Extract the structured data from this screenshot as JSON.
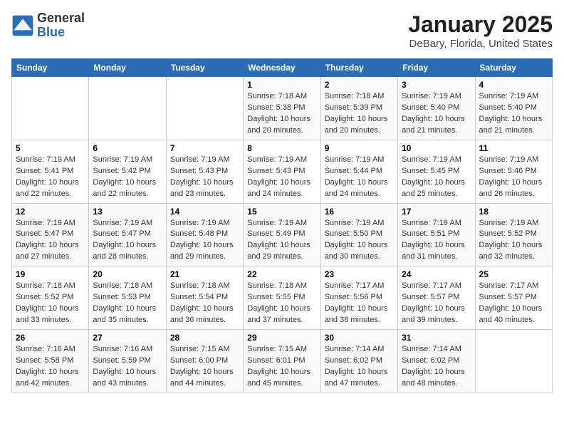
{
  "header": {
    "logo_line1": "General",
    "logo_line2": "Blue",
    "month": "January 2025",
    "location": "DeBary, Florida, United States"
  },
  "days_of_week": [
    "Sunday",
    "Monday",
    "Tuesday",
    "Wednesday",
    "Thursday",
    "Friday",
    "Saturday"
  ],
  "weeks": [
    [
      {
        "day": "",
        "info": ""
      },
      {
        "day": "",
        "info": ""
      },
      {
        "day": "",
        "info": ""
      },
      {
        "day": "1",
        "info": "Sunrise: 7:18 AM\nSunset: 5:38 PM\nDaylight: 10 hours\nand 20 minutes."
      },
      {
        "day": "2",
        "info": "Sunrise: 7:18 AM\nSunset: 5:39 PM\nDaylight: 10 hours\nand 20 minutes."
      },
      {
        "day": "3",
        "info": "Sunrise: 7:19 AM\nSunset: 5:40 PM\nDaylight: 10 hours\nand 21 minutes."
      },
      {
        "day": "4",
        "info": "Sunrise: 7:19 AM\nSunset: 5:40 PM\nDaylight: 10 hours\nand 21 minutes."
      }
    ],
    [
      {
        "day": "5",
        "info": "Sunrise: 7:19 AM\nSunset: 5:41 PM\nDaylight: 10 hours\nand 22 minutes."
      },
      {
        "day": "6",
        "info": "Sunrise: 7:19 AM\nSunset: 5:42 PM\nDaylight: 10 hours\nand 22 minutes."
      },
      {
        "day": "7",
        "info": "Sunrise: 7:19 AM\nSunset: 5:43 PM\nDaylight: 10 hours\nand 23 minutes."
      },
      {
        "day": "8",
        "info": "Sunrise: 7:19 AM\nSunset: 5:43 PM\nDaylight: 10 hours\nand 24 minutes."
      },
      {
        "day": "9",
        "info": "Sunrise: 7:19 AM\nSunset: 5:44 PM\nDaylight: 10 hours\nand 24 minutes."
      },
      {
        "day": "10",
        "info": "Sunrise: 7:19 AM\nSunset: 5:45 PM\nDaylight: 10 hours\nand 25 minutes."
      },
      {
        "day": "11",
        "info": "Sunrise: 7:19 AM\nSunset: 5:46 PM\nDaylight: 10 hours\nand 26 minutes."
      }
    ],
    [
      {
        "day": "12",
        "info": "Sunrise: 7:19 AM\nSunset: 5:47 PM\nDaylight: 10 hours\nand 27 minutes."
      },
      {
        "day": "13",
        "info": "Sunrise: 7:19 AM\nSunset: 5:47 PM\nDaylight: 10 hours\nand 28 minutes."
      },
      {
        "day": "14",
        "info": "Sunrise: 7:19 AM\nSunset: 5:48 PM\nDaylight: 10 hours\nand 29 minutes."
      },
      {
        "day": "15",
        "info": "Sunrise: 7:19 AM\nSunset: 5:49 PM\nDaylight: 10 hours\nand 29 minutes."
      },
      {
        "day": "16",
        "info": "Sunrise: 7:19 AM\nSunset: 5:50 PM\nDaylight: 10 hours\nand 30 minutes."
      },
      {
        "day": "17",
        "info": "Sunrise: 7:19 AM\nSunset: 5:51 PM\nDaylight: 10 hours\nand 31 minutes."
      },
      {
        "day": "18",
        "info": "Sunrise: 7:19 AM\nSunset: 5:52 PM\nDaylight: 10 hours\nand 32 minutes."
      }
    ],
    [
      {
        "day": "19",
        "info": "Sunrise: 7:18 AM\nSunset: 5:52 PM\nDaylight: 10 hours\nand 33 minutes."
      },
      {
        "day": "20",
        "info": "Sunrise: 7:18 AM\nSunset: 5:53 PM\nDaylight: 10 hours\nand 35 minutes."
      },
      {
        "day": "21",
        "info": "Sunrise: 7:18 AM\nSunset: 5:54 PM\nDaylight: 10 hours\nand 36 minutes."
      },
      {
        "day": "22",
        "info": "Sunrise: 7:18 AM\nSunset: 5:55 PM\nDaylight: 10 hours\nand 37 minutes."
      },
      {
        "day": "23",
        "info": "Sunrise: 7:17 AM\nSunset: 5:56 PM\nDaylight: 10 hours\nand 38 minutes."
      },
      {
        "day": "24",
        "info": "Sunrise: 7:17 AM\nSunset: 5:57 PM\nDaylight: 10 hours\nand 39 minutes."
      },
      {
        "day": "25",
        "info": "Sunrise: 7:17 AM\nSunset: 5:57 PM\nDaylight: 10 hours\nand 40 minutes."
      }
    ],
    [
      {
        "day": "26",
        "info": "Sunrise: 7:16 AM\nSunset: 5:58 PM\nDaylight: 10 hours\nand 42 minutes."
      },
      {
        "day": "27",
        "info": "Sunrise: 7:16 AM\nSunset: 5:59 PM\nDaylight: 10 hours\nand 43 minutes."
      },
      {
        "day": "28",
        "info": "Sunrise: 7:15 AM\nSunset: 6:00 PM\nDaylight: 10 hours\nand 44 minutes."
      },
      {
        "day": "29",
        "info": "Sunrise: 7:15 AM\nSunset: 6:01 PM\nDaylight: 10 hours\nand 45 minutes."
      },
      {
        "day": "30",
        "info": "Sunrise: 7:14 AM\nSunset: 6:02 PM\nDaylight: 10 hours\nand 47 minutes."
      },
      {
        "day": "31",
        "info": "Sunrise: 7:14 AM\nSunset: 6:02 PM\nDaylight: 10 hours\nand 48 minutes."
      },
      {
        "day": "",
        "info": ""
      }
    ]
  ]
}
